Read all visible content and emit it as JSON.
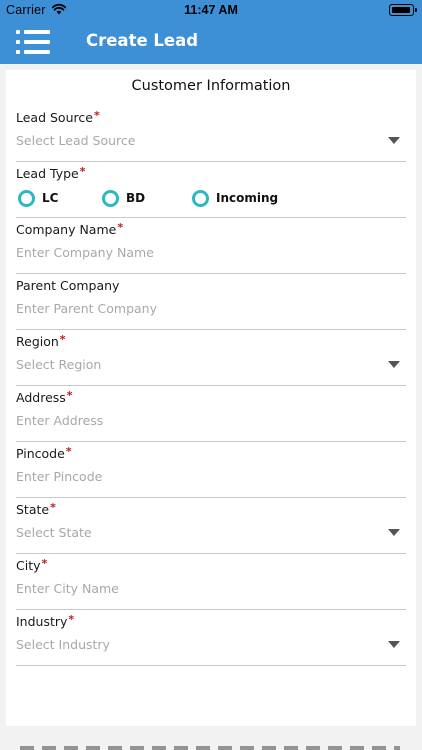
{
  "status_bar": {
    "carrier": "Carrier",
    "time": "11:47 AM"
  },
  "nav": {
    "title": "Create Lead",
    "menu_icon": "hamburger-list-icon",
    "bar_color": "#3d8fd6"
  },
  "form": {
    "section_title": "Customer Information",
    "required_mark": "*",
    "fields": [
      {
        "label": "Lead Source",
        "required": true,
        "type": "select",
        "placeholder": "Select Lead Source"
      },
      {
        "label": "Lead Type",
        "required": true,
        "type": "radio",
        "options": [
          "LC",
          "BD",
          "Incoming"
        ]
      },
      {
        "label": "Company Name",
        "required": true,
        "type": "text",
        "placeholder": "Enter Company Name"
      },
      {
        "label": "Parent Company",
        "required": false,
        "type": "text",
        "placeholder": "Enter Parent Company"
      },
      {
        "label": "Region",
        "required": true,
        "type": "select",
        "placeholder": "Select Region"
      },
      {
        "label": "Address",
        "required": true,
        "type": "text",
        "placeholder": "Enter Address"
      },
      {
        "label": "Pincode",
        "required": true,
        "type": "text",
        "placeholder": "Enter Pincode"
      },
      {
        "label": "State",
        "required": true,
        "type": "select",
        "placeholder": "Select State"
      },
      {
        "label": "City",
        "required": true,
        "type": "text",
        "placeholder": "Enter City Name"
      },
      {
        "label": "Industry",
        "required": true,
        "type": "select",
        "placeholder": "Select Industry"
      }
    ]
  },
  "colors": {
    "required": "#c0171a",
    "radio_accent": "#2bb8c0",
    "placeholder": "#a8a8a8"
  }
}
